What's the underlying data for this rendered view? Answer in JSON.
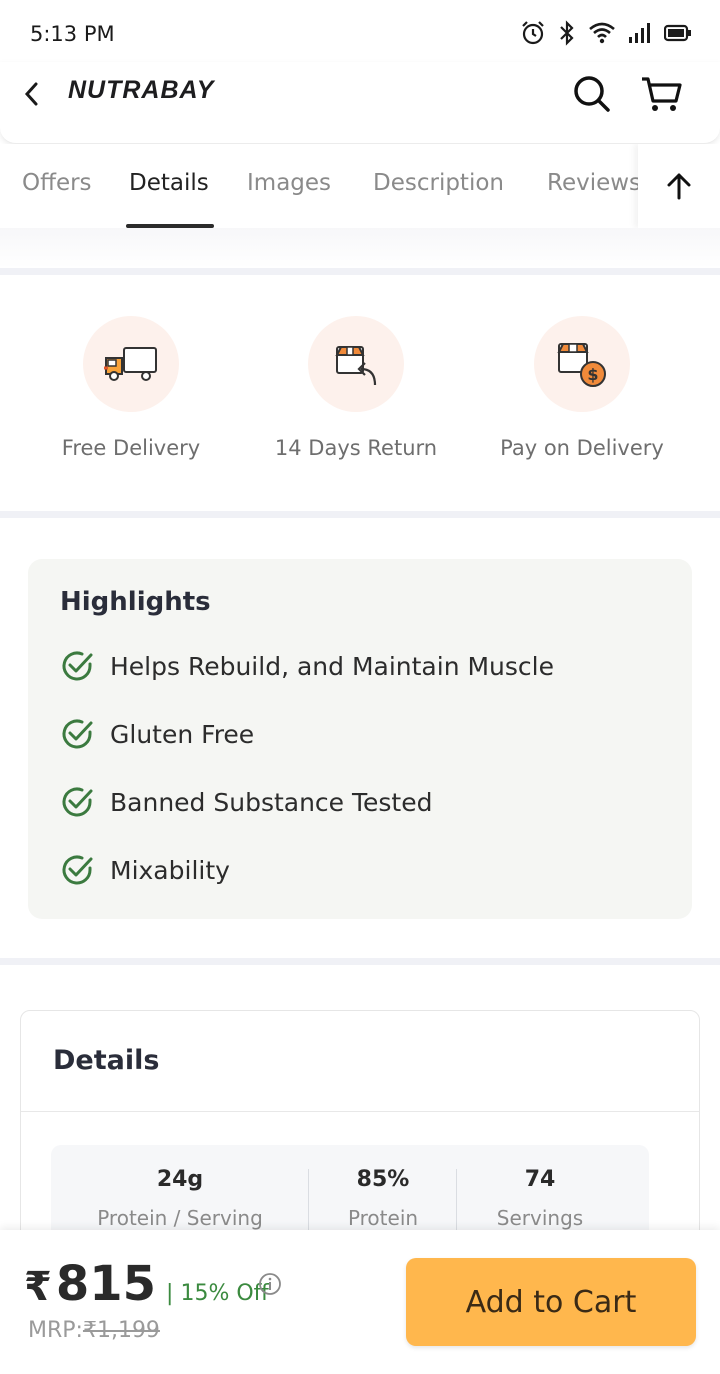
{
  "status_bar": {
    "time": "5:13 PM",
    "icons": [
      "alarm-icon",
      "bluetooth-icon",
      "wifi-icon",
      "signal-icon",
      "battery-icon"
    ]
  },
  "header": {
    "logo": "NUTRABAY",
    "icons": [
      "back-arrow-icon",
      "search-icon",
      "cart-icon"
    ]
  },
  "tabs": {
    "items": [
      "Offers",
      "Details",
      "Images",
      "Description",
      "Reviews"
    ],
    "active": "Details",
    "scroll_top_icon": "arrow-up-icon"
  },
  "features": [
    {
      "label": "Free Delivery",
      "icon": "truck-icon"
    },
    {
      "label": "14 Days Return",
      "icon": "box-return-icon"
    },
    {
      "label": "Pay on Delivery",
      "icon": "box-cash-icon"
    }
  ],
  "highlights": {
    "title": "Highlights",
    "items": [
      "Helps Rebuild, and Maintain Muscle",
      "Gluten Free",
      "Banned Substance Tested",
      "Mixability"
    ],
    "check_color": "#3b7a3f"
  },
  "details": {
    "title": "Details",
    "stats": [
      {
        "value": "24g",
        "label": "Protein / Serving"
      },
      {
        "value": "85%",
        "label": "Protein"
      },
      {
        "value": "74",
        "label": "Servings"
      }
    ]
  },
  "bottom_bar": {
    "currency": "₹",
    "price": "815",
    "discount": "| 15% Off",
    "mrp_label": "MRP:",
    "mrp_value": "₹1,199",
    "add_to_cart": "Add to Cart",
    "button_color": "#ffb74d"
  }
}
